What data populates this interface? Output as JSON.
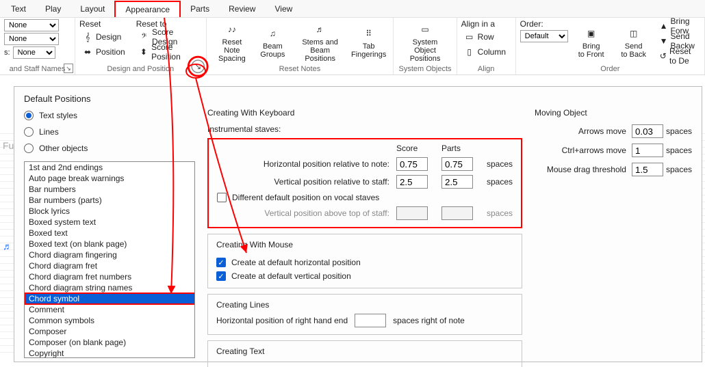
{
  "menu": {
    "tabs": [
      "Text",
      "Play",
      "Layout",
      "Appearance",
      "Parts",
      "Review",
      "View"
    ],
    "selected": 3
  },
  "ribbon": {
    "combos": {
      "a": "None",
      "b": "None",
      "c": "None"
    },
    "staffnames_caption": "and Staff Names",
    "reset": {
      "reset_label": "Reset",
      "reset_to_label": "Reset to",
      "design": "Design",
      "position": "Position",
      "score_design": "Score Design",
      "score_position": "Score Position",
      "caption": "Design and Position"
    },
    "notes": {
      "reset_note_spacing": "Reset Note\nSpacing",
      "beam_groups": "Beam\nGroups",
      "stems_beam": "Stems and\nBeam Positions",
      "tab_fingerings": "Tab\nFingerings",
      "caption": "Reset Notes"
    },
    "sysobj": {
      "label": "System Object\nPositions",
      "caption": "System Objects"
    },
    "align": {
      "title": "Align in a",
      "row": "Row",
      "column": "Column",
      "caption": "Align"
    },
    "order": {
      "title": "Order:",
      "value": "Default",
      "bring_front": "Bring\nto Front",
      "send_back": "Send\nto Back",
      "bring_forw": "Bring Forw",
      "send_backw": "Send Backw",
      "reset_de": "Reset to De",
      "caption": "Order"
    }
  },
  "dialog": {
    "title": "Default Positions",
    "radios": [
      "Text styles",
      "Lines",
      "Other objects"
    ],
    "radio_selected": 0,
    "list": [
      "1st and 2nd endings",
      "Auto page break warnings",
      "Bar numbers",
      "Bar numbers (parts)",
      "Block lyrics",
      "Boxed system text",
      "Boxed text",
      "Boxed text (on blank page)",
      "Chord diagram fingering",
      "Chord diagram fret",
      "Chord diagram fret numbers",
      "Chord diagram string names",
      "Chord symbol",
      "Comment",
      "Common symbols",
      "Composer",
      "Composer (on blank page)",
      "Copyright"
    ],
    "list_selected": 12,
    "kb": {
      "title": "Creating With Keyboard",
      "subtitle": "Instrumental staves:",
      "col_score": "Score",
      "col_parts": "Parts",
      "hpos_label": "Horizontal position relative to note:",
      "hpos_score": "0.75",
      "hpos_parts": "0.75",
      "vpos_label": "Vertical position relative to staff:",
      "vpos_score": "2.5",
      "vpos_parts": "2.5",
      "unit": "spaces",
      "diff_vocal": "Different default position on vocal staves",
      "vocal_label": "Vertical position above top of staff:"
    },
    "mouse": {
      "title": "Creating With Mouse",
      "chk_h": "Create at default horizontal position",
      "chk_v": "Create at default vertical position"
    },
    "lines": {
      "title": "Creating Lines",
      "rh_label": "Horizontal position of right hand end",
      "rh_unit": "spaces right of note"
    },
    "text_sec": {
      "title": "Creating Text"
    },
    "moving": {
      "title": "Moving Object",
      "arrows": "Arrows move",
      "arrows_val": "0.03",
      "ctrl_arrows": "Ctrl+arrows move",
      "ctrl_arrows_val": "1",
      "drag": "Mouse drag threshold",
      "drag_val": "1.5",
      "unit": "spaces"
    }
  }
}
